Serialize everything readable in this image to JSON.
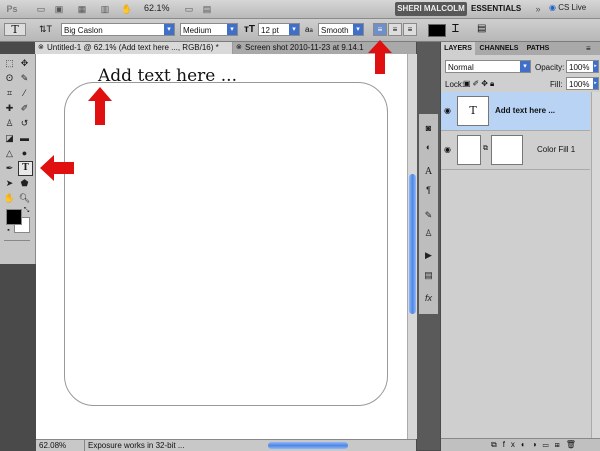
{
  "app": {
    "logo": "Ps",
    "zoom": "62.1%",
    "user_button": "SHERI MALCOLM",
    "workspace_button": "ESSENTIALS",
    "cs_live": "CS Live"
  },
  "options_bar": {
    "tool_icon": "T",
    "font_family": "Big Caslon",
    "font_style": "Medium",
    "font_size": "12 pt",
    "aa_label": "a",
    "antialias": "Smooth"
  },
  "tabs": [
    {
      "label": "Untitled-1 @ 62.1% (Add text here ..., RGB/16) *"
    },
    {
      "label": "Screen shot 2010-11-23 at 9.14.1"
    }
  ],
  "document": {
    "text": "Add text here ..."
  },
  "status": {
    "zoom": "62.08%",
    "message": "Exposure works in 32-bit ..."
  },
  "panel": {
    "tabs": [
      "LAYERS",
      "CHANNELS",
      "PATHS"
    ],
    "blend_mode": "Normal",
    "opacity_label": "Opacity:",
    "opacity_value": "100%",
    "lock_label": "Lock:",
    "fill_label": "Fill:",
    "fill_value": "100%",
    "layers": [
      {
        "name": "Add text here ...",
        "thumb": "T",
        "selected": true
      },
      {
        "name": "Color Fill 1",
        "selected": false
      }
    ]
  },
  "colors": {
    "accent": "#3f6fc9",
    "selected_layer": "#b9d3f5",
    "arrow": "#e01010"
  }
}
